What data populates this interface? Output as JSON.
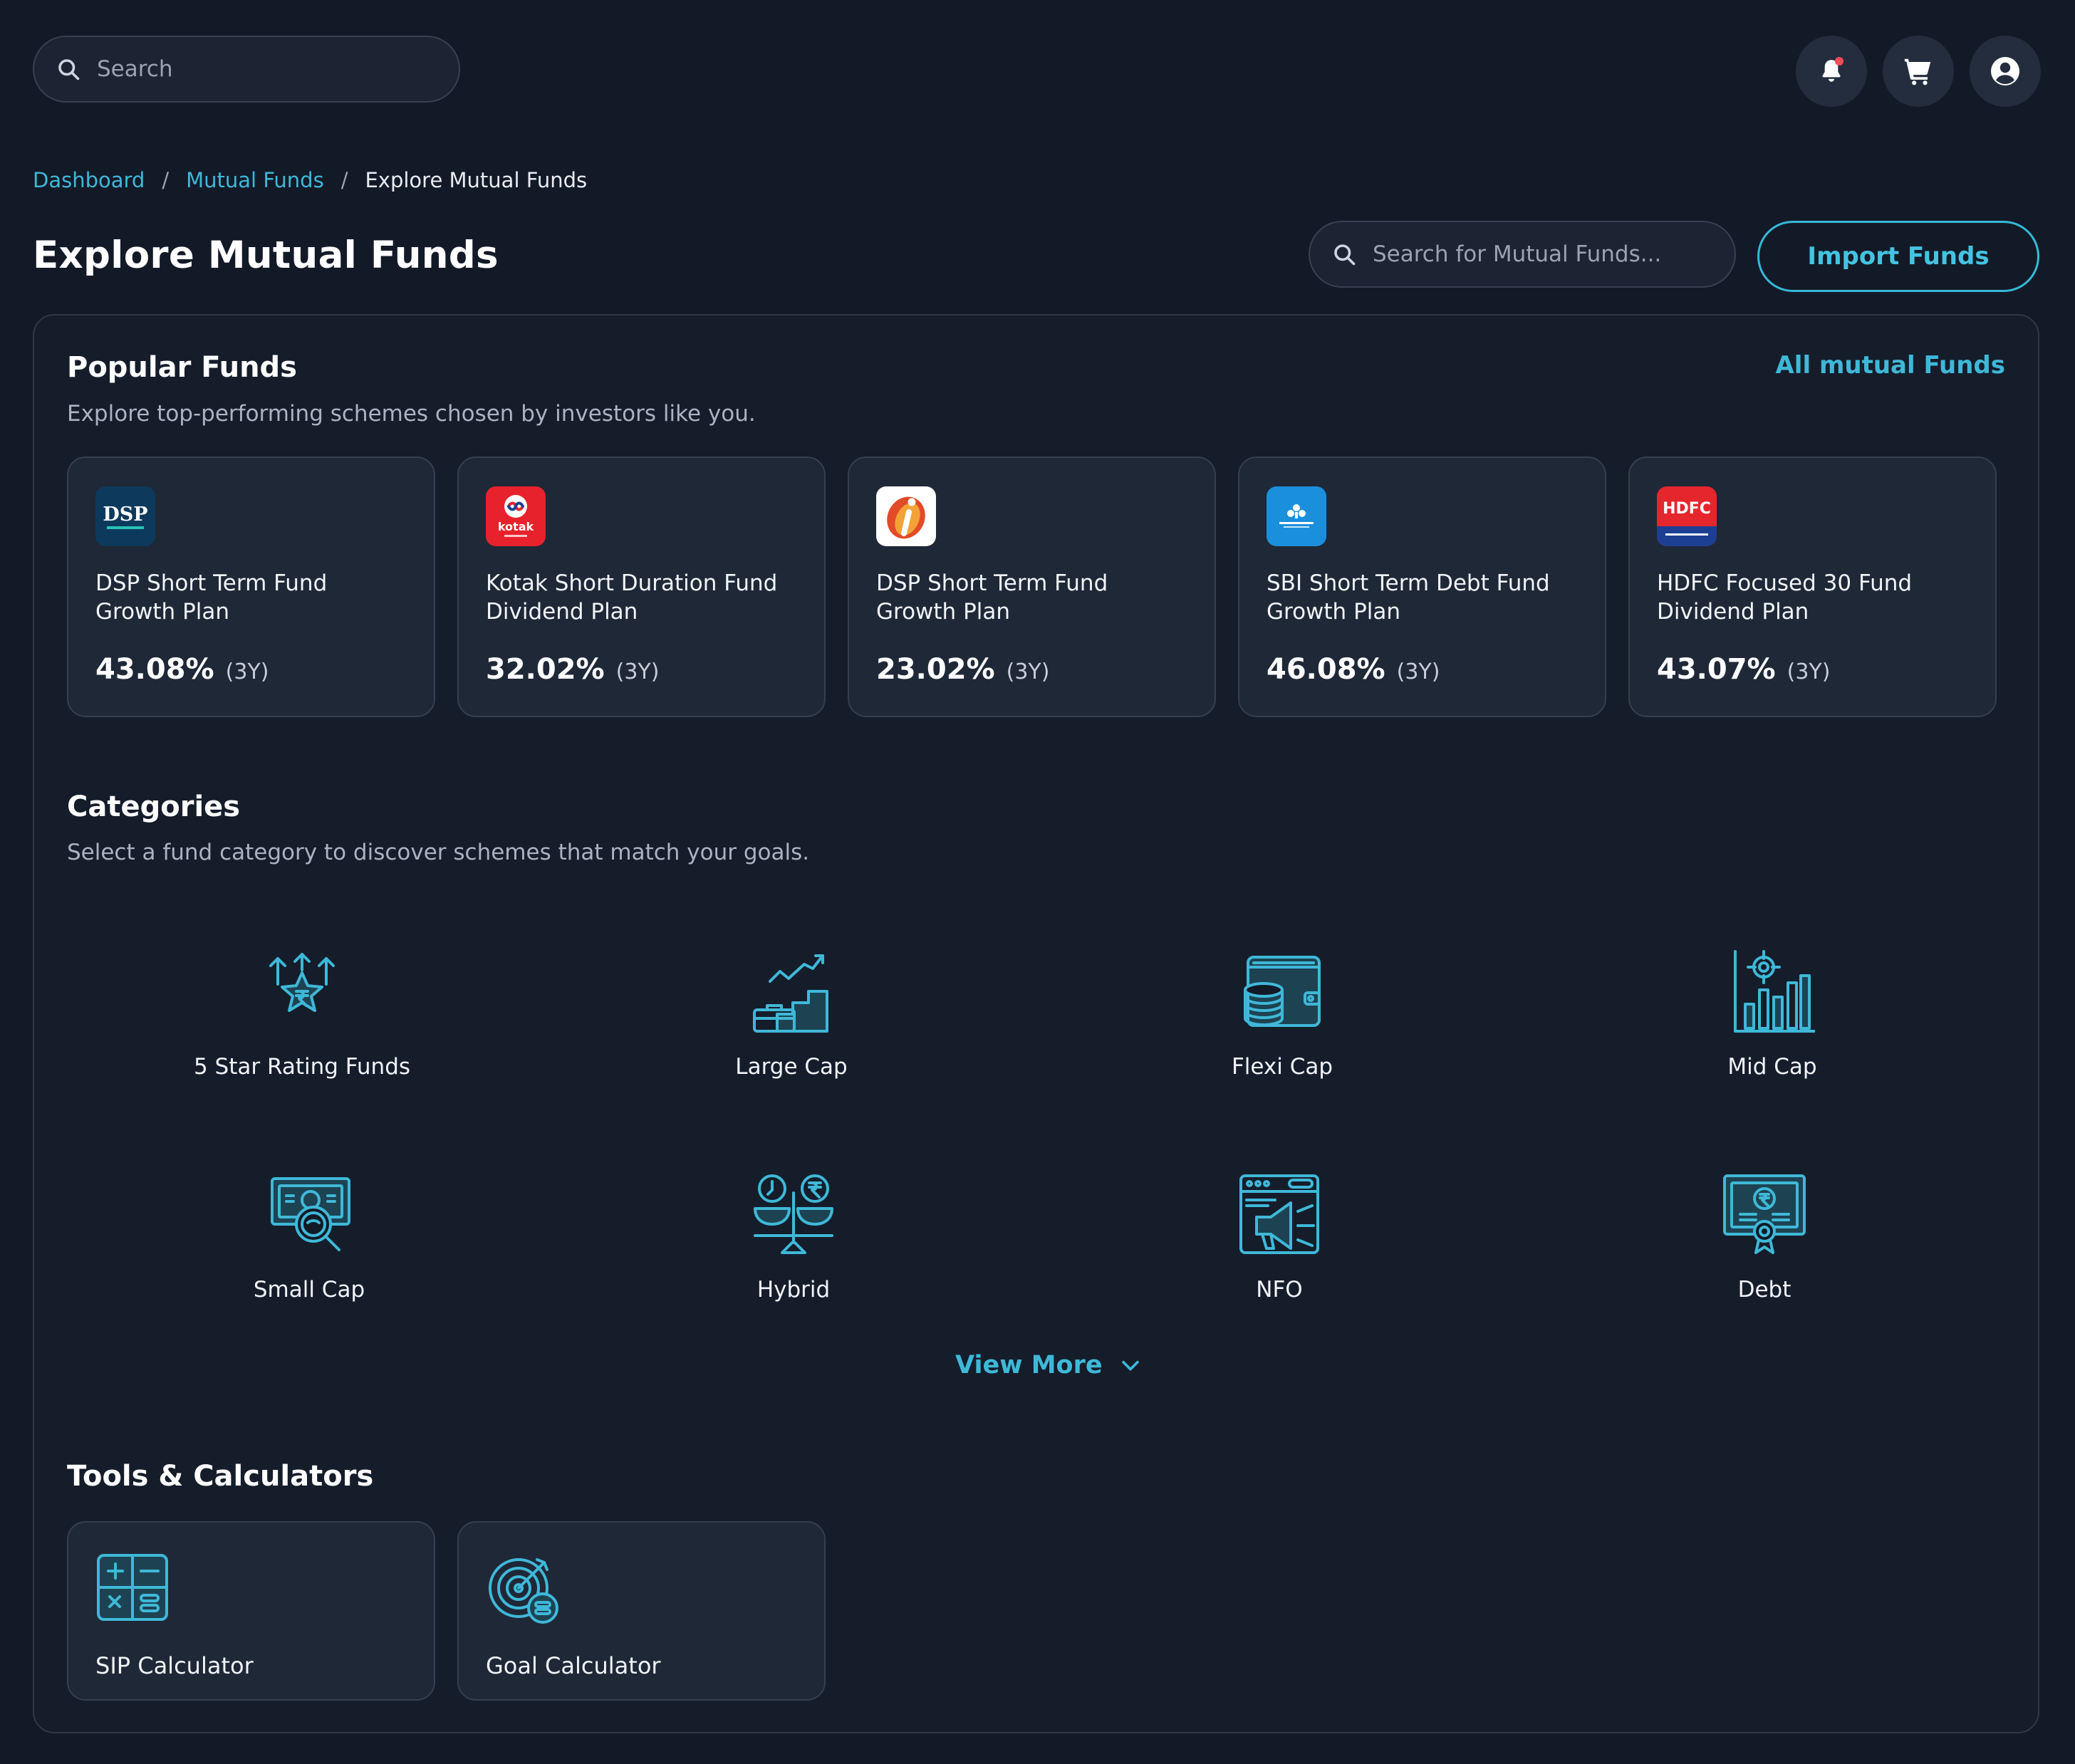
{
  "header": {
    "search_placeholder": "Search",
    "icons": [
      "bell-icon",
      "cart-icon",
      "user-icon"
    ]
  },
  "breadcrumb": {
    "items": [
      "Dashboard",
      "Mutual Funds"
    ],
    "separator": "/",
    "current": "Explore Mutual Funds"
  },
  "page": {
    "title": "Explore Mutual Funds",
    "fund_search_placeholder": "Search for Mutual Funds...",
    "import_label": "Import Funds"
  },
  "popular": {
    "title": "Popular Funds",
    "subtitle": "Explore top-performing schemes chosen by investors like you.",
    "all_link": "All mutual Funds",
    "funds": [
      {
        "name_line1": "DSP Short Term Fund",
        "name_line2": "Growth Plan",
        "return": "43.08%",
        "period": "(3Y)",
        "logo": "DSP"
      },
      {
        "name_line1": "Kotak Short Duration Fund",
        "name_line2": "Dividend Plan",
        "return": "32.02%",
        "period": "(3Y)",
        "logo": "kotak"
      },
      {
        "name_line1": "DSP Short Term Fund",
        "name_line2": "Growth Plan",
        "return": "23.02%",
        "period": "(3Y)",
        "logo": "icici"
      },
      {
        "name_line1": "SBI Short Term Debt Fund",
        "name_line2": "Growth Plan",
        "return": "46.08%",
        "period": "(3Y)",
        "logo": "sbi"
      },
      {
        "name_line1": "HDFC Focused 30 Fund",
        "name_line2": "Dividend Plan",
        "return": "43.07%",
        "period": "(3Y)",
        "logo": "HDFC"
      }
    ]
  },
  "categories": {
    "title": "Categories",
    "subtitle": "Select a fund category to discover schemes that match your goals.",
    "items": [
      {
        "label": "5 Star Rating Funds",
        "icon": "star-rupee-icon"
      },
      {
        "label": "Large Cap",
        "icon": "growth-stairs-icon"
      },
      {
        "label": "Flexi Cap",
        "icon": "wallet-coins-icon"
      },
      {
        "label": "Mid Cap",
        "icon": "target-bars-icon"
      },
      {
        "label": "Small Cap",
        "icon": "money-search-icon"
      },
      {
        "label": "Hybrid",
        "icon": "balance-scale-icon"
      },
      {
        "label": "NFO",
        "icon": "megaphone-browser-icon"
      },
      {
        "label": "Debt",
        "icon": "certificate-icon"
      }
    ],
    "view_more": "View More"
  },
  "tools": {
    "title": "Tools & Calculators",
    "items": [
      {
        "label": "SIP Calculator",
        "icon": "calculator-icon"
      },
      {
        "label": "Goal Calculator",
        "icon": "goal-target-icon"
      }
    ]
  },
  "colors": {
    "background": "#131a27",
    "panel": "#151d2b",
    "card": "#1f2837",
    "accent": "#3fb8d8"
  }
}
